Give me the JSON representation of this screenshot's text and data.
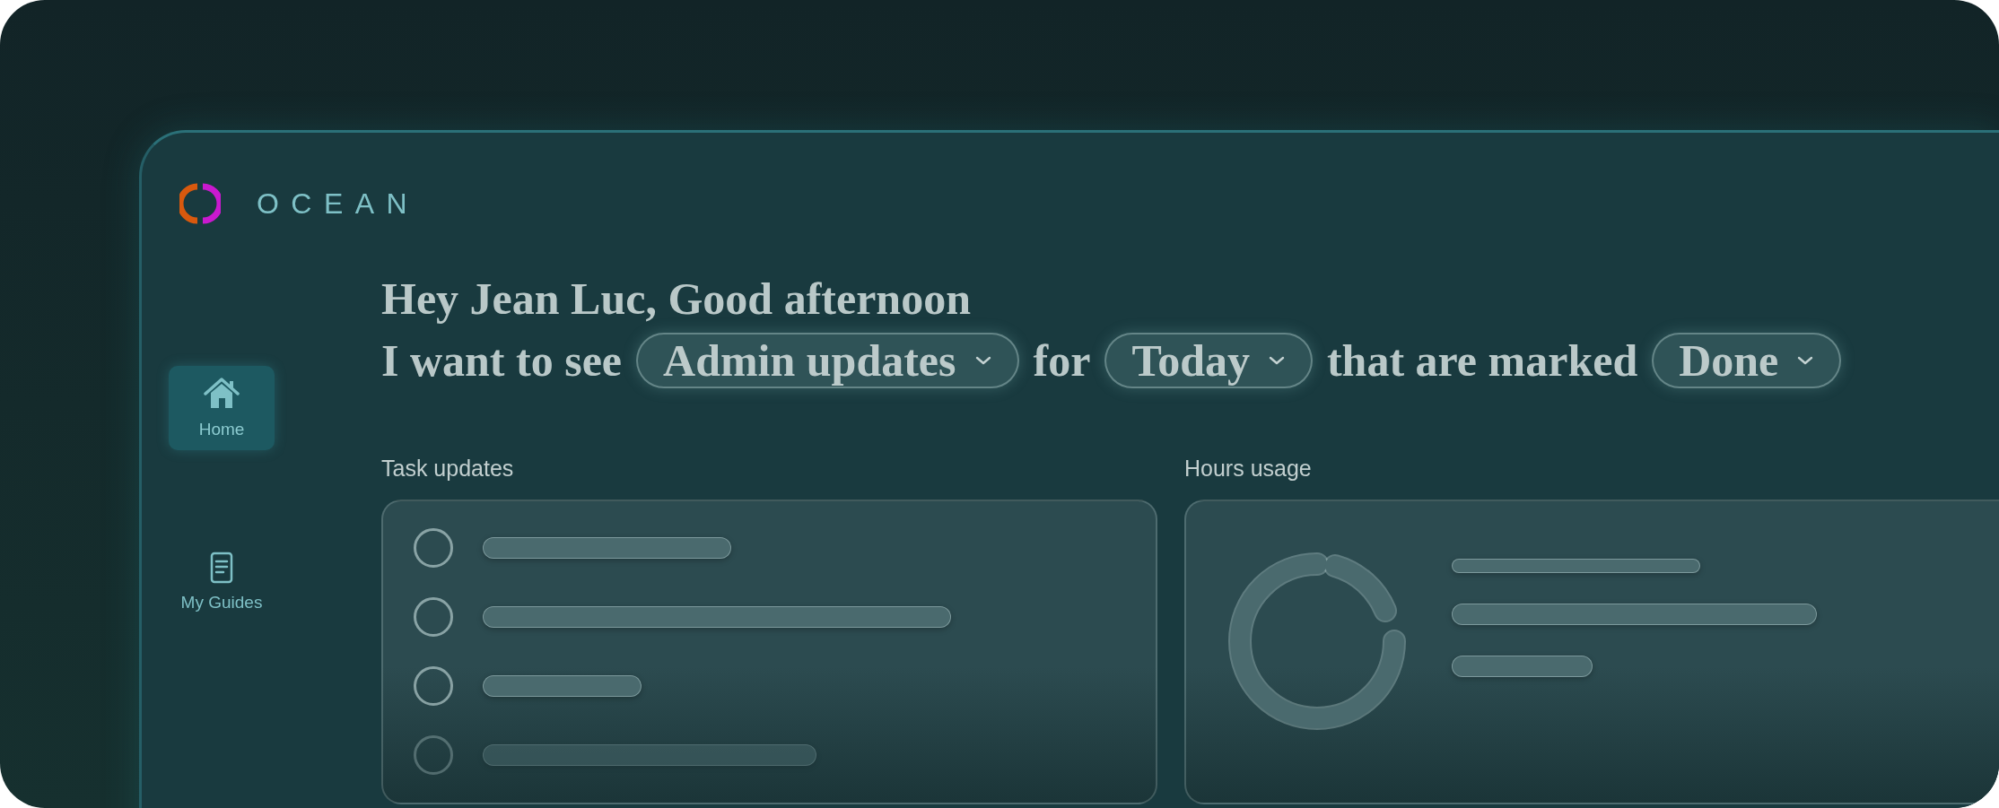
{
  "brand": {
    "name": "OCEAN"
  },
  "nav": [
    {
      "label": "Home",
      "kind": "home",
      "selected": true
    },
    {
      "label": "My Guides",
      "kind": "guide",
      "selected": false
    }
  ],
  "greeting": "Hey Jean Luc, Good afternoon",
  "filter": [
    {
      "kind": "text",
      "text": "I want to see"
    },
    {
      "kind": "dropdown",
      "text": "Admin updates"
    },
    {
      "kind": "text",
      "text": "for"
    },
    {
      "kind": "dropdown",
      "text": "Today"
    },
    {
      "kind": "text",
      "text": "that are marked"
    },
    {
      "kind": "dropdown",
      "text": "Done"
    }
  ],
  "panels": [
    {
      "kind": "tasks",
      "title": "Task updates"
    },
    {
      "kind": "usage",
      "title": "Hours usage"
    }
  ]
}
